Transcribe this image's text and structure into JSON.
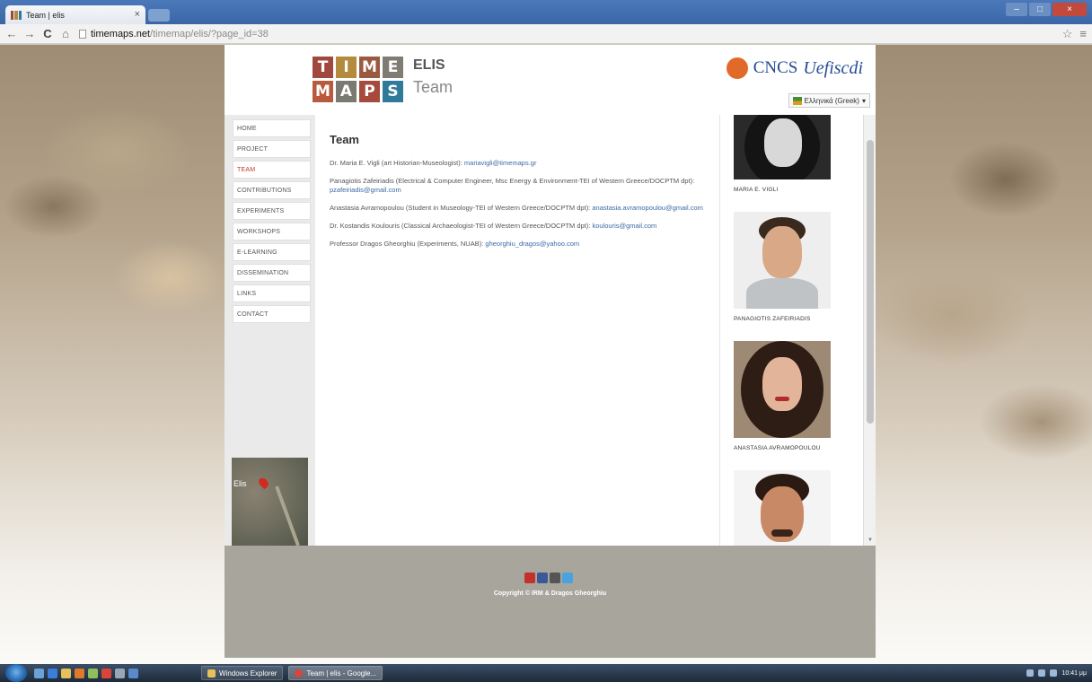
{
  "browser": {
    "tab_title": "Team | elis",
    "tab_close": "×",
    "url_host": "timemaps.net",
    "url_path": "/timemap/elis/?page_id=38"
  },
  "header": {
    "logo_row1": [
      "T",
      "I",
      "M",
      "E"
    ],
    "logo_row2": [
      "M",
      "A",
      "P",
      "S"
    ],
    "site_name": "ELIS",
    "site_sub": "Team",
    "partner_name": "CNCS",
    "partner_script": "Uefiscdi",
    "language": "Ελληνικά (Greek)"
  },
  "nav": {
    "items": [
      "HOME",
      "PROJECT",
      "TEAM",
      "CONTRIBUTIONS",
      "EXPERIMENTS",
      "WORKSHOPS",
      "E-LEARNING",
      "DISSEMINATION",
      "LINKS",
      "CONTACT"
    ],
    "active_index": 2
  },
  "map": {
    "pin_label": "Elis"
  },
  "content": {
    "title": "Team",
    "members": [
      {
        "text": "Dr. Maria E. Vigli (art Historian-Museologist): ",
        "email": "mariavigli@timemaps.gr"
      },
      {
        "text": "Panagiotis Zafeiriadis (Electrical & Computer Engineer, Msc Energy & Environment-TEI of Western Greece/DOCPTM dpt): ",
        "email": "pzafeiriadis@gmail.com"
      },
      {
        "text": "Anastasia Avramopoulou (Student in Museology-TEI of Western Greece/DOCPTM dpt): ",
        "email": "anastasia.avramopoulou@gmail.com"
      },
      {
        "text": "Dr. Kostandis Koulouris (Classical Archaeologist-TEI of Western Greece/DOCPTM dpt): ",
        "email": "koulouris@gmail.com"
      },
      {
        "text": "Professor Dragos Gheorghiu (Experiments, NUAB): ",
        "email": "gheorghiu_dragos@yahoo.com"
      }
    ]
  },
  "sidebar": {
    "people": [
      "MARIA E. VIGLI",
      "PANAGIOTIS ZAFEIRIADIS",
      "ANASTASIA AVRAMOPOULOU",
      ""
    ]
  },
  "footer": {
    "copyright": "Copyright © IRM & Dragos Gheorghiu",
    "social": [
      "yt",
      "f",
      "g",
      "t"
    ]
  },
  "taskbar": {
    "tasks": [
      "Windows Explorer",
      "Team | elis - Google..."
    ],
    "clock": "10:41 μμ"
  },
  "colors": {
    "logo_t": "#a0483e",
    "logo_i": "#b38a3e",
    "logo_m": "#9a5a42",
    "logo_e": "#7f7d73",
    "logo_m2": "#b9593d",
    "logo_a": "#7b7a72",
    "logo_p": "#a64a3d",
    "logo_s": "#2f7a9a",
    "active_nav": "#c0392b",
    "link": "#3b6aa6"
  }
}
